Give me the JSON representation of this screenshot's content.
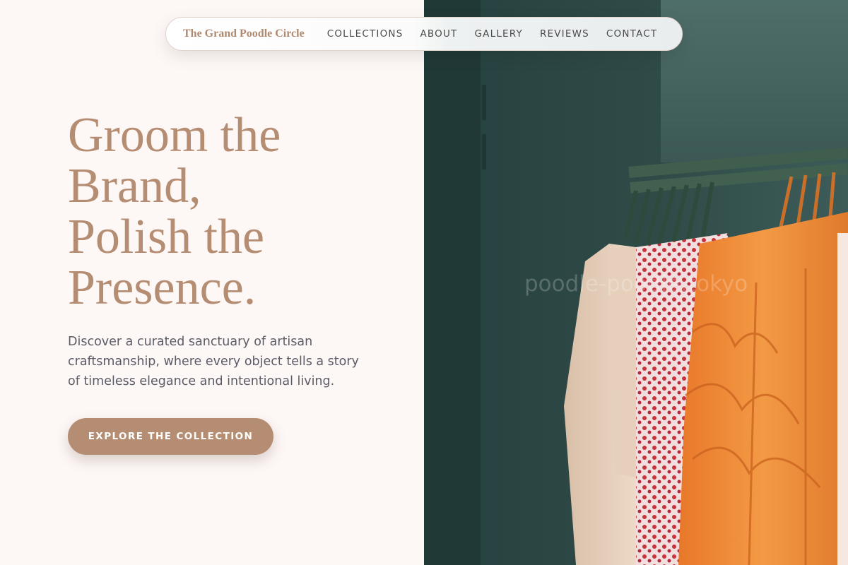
{
  "nav": {
    "brand": "The Grand Poodle Circle",
    "links": [
      "COLLECTIONS",
      "ABOUT",
      "GALLERY",
      "REVIEWS",
      "CONTACT"
    ]
  },
  "hero": {
    "title_lines": [
      "Groom the",
      "Brand,",
      "Polish the",
      "Presence."
    ],
    "description": "Discover a curated sanctuary of artisan craftsmanship, where every object tells a story of timeless elegance and intentional living.",
    "cta_label": "EXPLORE THE COLLECTION"
  },
  "image": {
    "subject": "clothing-rack-photo",
    "watermark": "poodle-poodle.tokyo"
  },
  "colors": {
    "accent": "#b48d73",
    "background": "#fdf7f6",
    "text_muted": "#5b5b66"
  }
}
